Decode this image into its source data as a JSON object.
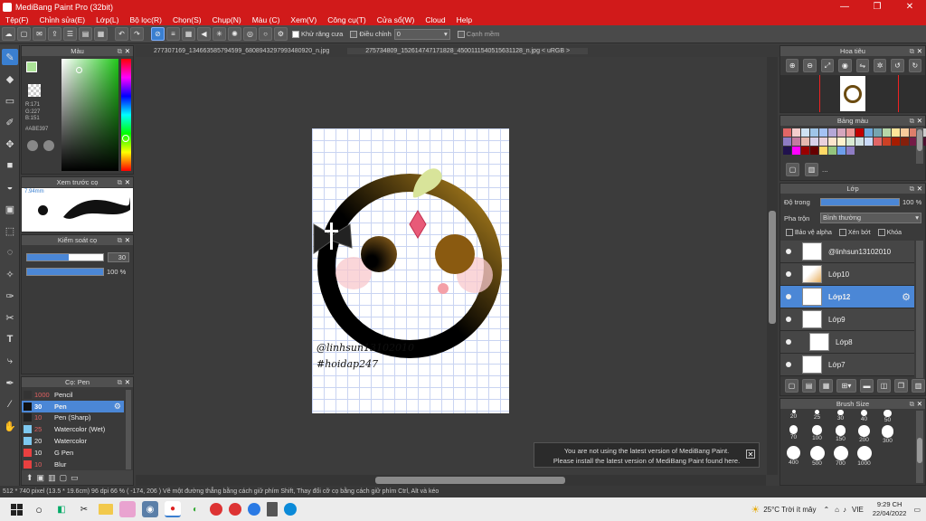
{
  "app": {
    "title": "MediBang Paint Pro (32bit)"
  },
  "menu": [
    "Tệp(F)",
    "Chỉnh sửa(E)",
    "Lớp(L)",
    "Bộ lọc(R)",
    "Chọn(S)",
    "Chụp(N)",
    "Màu (C)",
    "Xem(V)",
    "Công cụ(T)",
    "Cửa sổ(W)",
    "Cloud",
    "Help"
  ],
  "toolbar": {
    "antialias": "Khử răng cưa",
    "correction": "Điều chỉnh",
    "correction_value": "0",
    "edge": "Cạnh mềm"
  },
  "tabs": [
    "277307169_1346635857945​99_6808943297993480920_n.jpg",
    "275734809_1526147471718​28_4500111540515631128_n.jpg < uRGB >"
  ],
  "color_panel": {
    "title": "Màu",
    "r": "R:171",
    "g": "G:227",
    "b": "B:151",
    "hex": "#ABE397",
    "fg": "#ABE397"
  },
  "brush_preview": {
    "title": "Xem trước cọ",
    "size": "7.94mm"
  },
  "brush_control": {
    "title": "Kiểm soát cọ",
    "size": "30",
    "opacity": "100 %"
  },
  "brush_list": {
    "title": "Cọ: Pen",
    "items": [
      {
        "size": "1000",
        "name": "Pencil",
        "color": "#333333"
      },
      {
        "size": "30",
        "name": "Pen",
        "color": "#111111",
        "selected": true
      },
      {
        "size": "10",
        "name": "Pen (Sharp)",
        "color": "#222222"
      },
      {
        "size": "25",
        "name": "Watercolor (Wet)",
        "color": "#7ec8f0"
      },
      {
        "size": "20",
        "name": "Watercolor",
        "color": "#7ec8f0"
      },
      {
        "size": "10",
        "name": "G Pen",
        "color": "#e84040"
      },
      {
        "size": "10",
        "name": "Blur",
        "color": "#e84040"
      }
    ]
  },
  "navigator": {
    "title": "Hoa tiêu"
  },
  "palette_panel": {
    "title": "Bảng màu",
    "more": "...",
    "colors": [
      "#e06666",
      "#f4cccc",
      "#cfe2f3",
      "#9fc5e8",
      "#a4c2f4",
      "#b4a7d6",
      "#d5a6bd",
      "#ea9999",
      "#c00000",
      "#6fa8dc",
      "#76a5af",
      "#b6d7a8",
      "#ffe599",
      "#f9cb9c",
      "#dd7e6b",
      "#cccccc",
      "#8e7cc3",
      "#c27ba0",
      "#e6b8af",
      "#d9d2e9",
      "#ead1dc",
      "#fce5cd",
      "#fff2cc",
      "#d9ead3",
      "#d0e0e3",
      "#c9daf8",
      "#e06666",
      "#cc4125",
      "#a61c00",
      "#85200c",
      "#741b47",
      "#4c1130",
      "#20124d",
      "#ff00ff",
      "#990000",
      "#660000",
      "#ffd966",
      "#93c47d",
      "#6d9eeb",
      "#8e7cc3"
    ]
  },
  "layer_panel": {
    "title": "Lớp",
    "opacity_label": "Độ trong",
    "opacity": "100 %",
    "blend_label": "Pha trộn",
    "blend": "Bình thường",
    "protect": "Bảo vệ alpha",
    "clip": "Xén bớt",
    "lock": "Khóa",
    "layers": [
      {
        "name": "@linhsun13102010"
      },
      {
        "name": "Lớp10"
      },
      {
        "name": "Lớp12",
        "selected": true
      },
      {
        "name": "Lớp9"
      },
      {
        "name": "Lớp8"
      },
      {
        "name": "Lớp7"
      }
    ]
  },
  "brush_size": {
    "title": "Brush Size",
    "sizes": [
      "20",
      "25",
      "30",
      "40",
      "50",
      "70",
      "100",
      "150",
      "200",
      "300",
      "400",
      "500",
      "700",
      "1000"
    ]
  },
  "canvas": {
    "text1": "@linhsun13102010",
    "text2": "#hoidap247"
  },
  "notification": {
    "line1": "You are not using the latest version of MediBang Paint.",
    "line2": "Please install the latest version of MediBang Paint found here."
  },
  "status": "512 * 740 pixel   (13.5 * 19.6cm)   96 dpi   66 %   ( -174, 206 )   Vẽ một đường thẳng bằng cách giữ phím Shift, Thay đổi cỡ cọ bằng cách giữ phím Ctrl, Alt và kéo",
  "taskbar": {
    "weather": "25°C  Trời ít mây",
    "lang": "VIE",
    "time": "9:29 CH",
    "date": "22/04/2022"
  }
}
